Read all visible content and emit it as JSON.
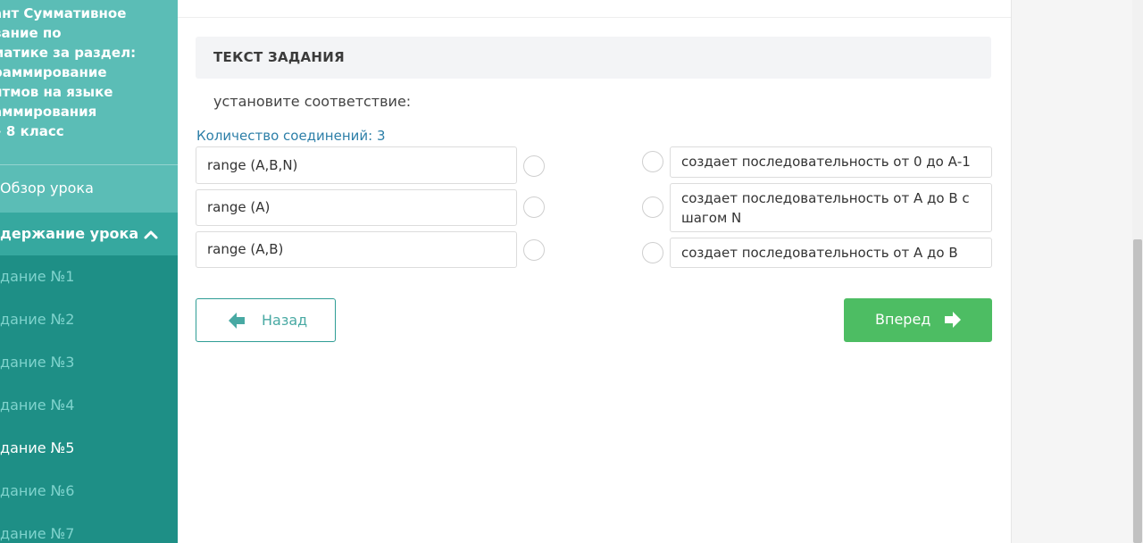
{
  "sidebar": {
    "title": "ант Суммативное\nвание по\nматике за раздел:\nраммирование\nитмов на языке\nаммирования\n» 8 класс",
    "overview": "Обзор урока",
    "content_header": "держание урока",
    "items": [
      {
        "label": "дание №1"
      },
      {
        "label": "дание №2"
      },
      {
        "label": "дание №3"
      },
      {
        "label": "дание №4"
      },
      {
        "label": "дание №5"
      },
      {
        "label": "дание №6"
      },
      {
        "label": "дание №7"
      }
    ],
    "active_index": 4
  },
  "task": {
    "header": "ТЕКСТ ЗАДАНИЯ",
    "instruction": "установите соответствие:",
    "connections": "Количество соединений: 3",
    "left_items": [
      "range (A,B,N)",
      "range (A)",
      "range (A,B)"
    ],
    "right_items": [
      "создает последовательность от 0 до А-1",
      "создает последовательность от А до В с шагом N",
      "создает последовательность от А до В"
    ]
  },
  "nav": {
    "back_label": "Назад",
    "next_label": "Вперед"
  },
  "colors": {
    "sidebar_bg": "#5bbdb6",
    "sidebar_active_section": "#36a89f",
    "sidebar_list_bg": "#1e8f86",
    "next_button": "#4dbd63",
    "back_border": "#2f9d95",
    "connections_text": "#2d7fa8"
  },
  "icons": {
    "sidebar_chevron": "chevron-up-icon",
    "back_arrow": "arrow-left-icon",
    "next_arrow": "arrow-right-icon"
  }
}
